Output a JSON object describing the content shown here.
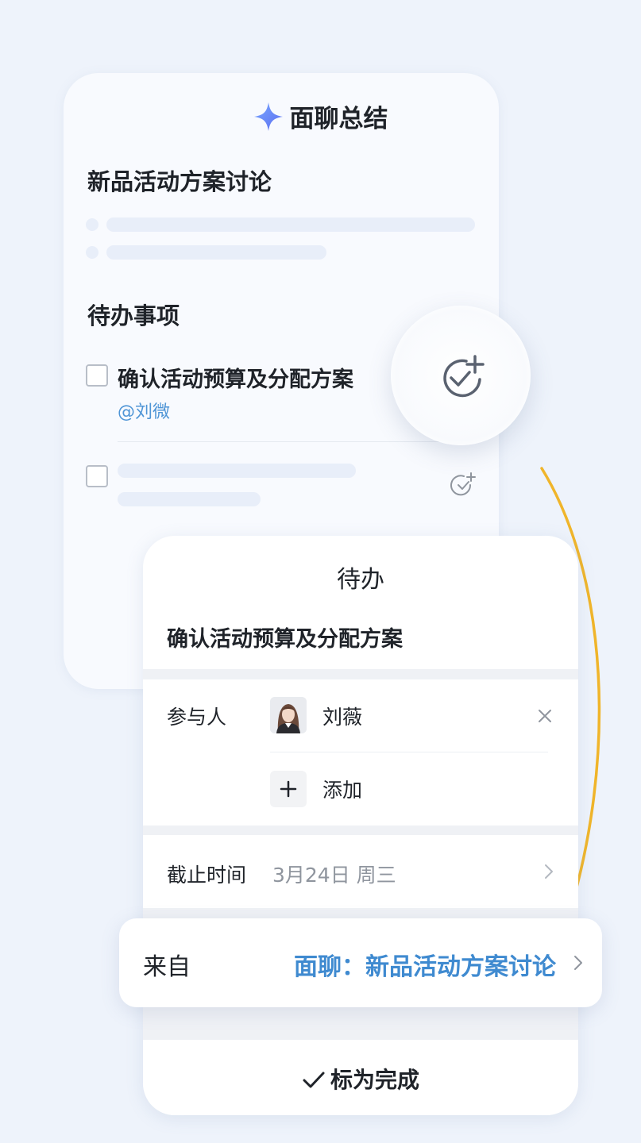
{
  "summary": {
    "title": "面聊总结",
    "meeting_title": "新品活动方案讨论",
    "todo_section": "待办事项",
    "todo_item": "确认活动预算及分配方案",
    "mention": "@刘微"
  },
  "todo_card": {
    "title": "待办",
    "task": "确认活动预算及分配方案",
    "participants_label": "参与人",
    "participant_name": "刘薇",
    "add_label": "添加",
    "deadline_label": "截止时间",
    "deadline_value": "3月24日 周三",
    "complete_label": "标为完成"
  },
  "source": {
    "label": "来自",
    "value": "面聊：新品活动方案讨论"
  },
  "colors": {
    "accent_blue": "#3f8ad0",
    "mention_blue": "#4f95d6",
    "curve_yellow": "#f0b52a",
    "background": "#eef3fb"
  },
  "icons": [
    "sparkle-icon",
    "add-todo-icon",
    "close-icon",
    "plus-icon",
    "chevron-right-icon",
    "checkmark-icon"
  ]
}
